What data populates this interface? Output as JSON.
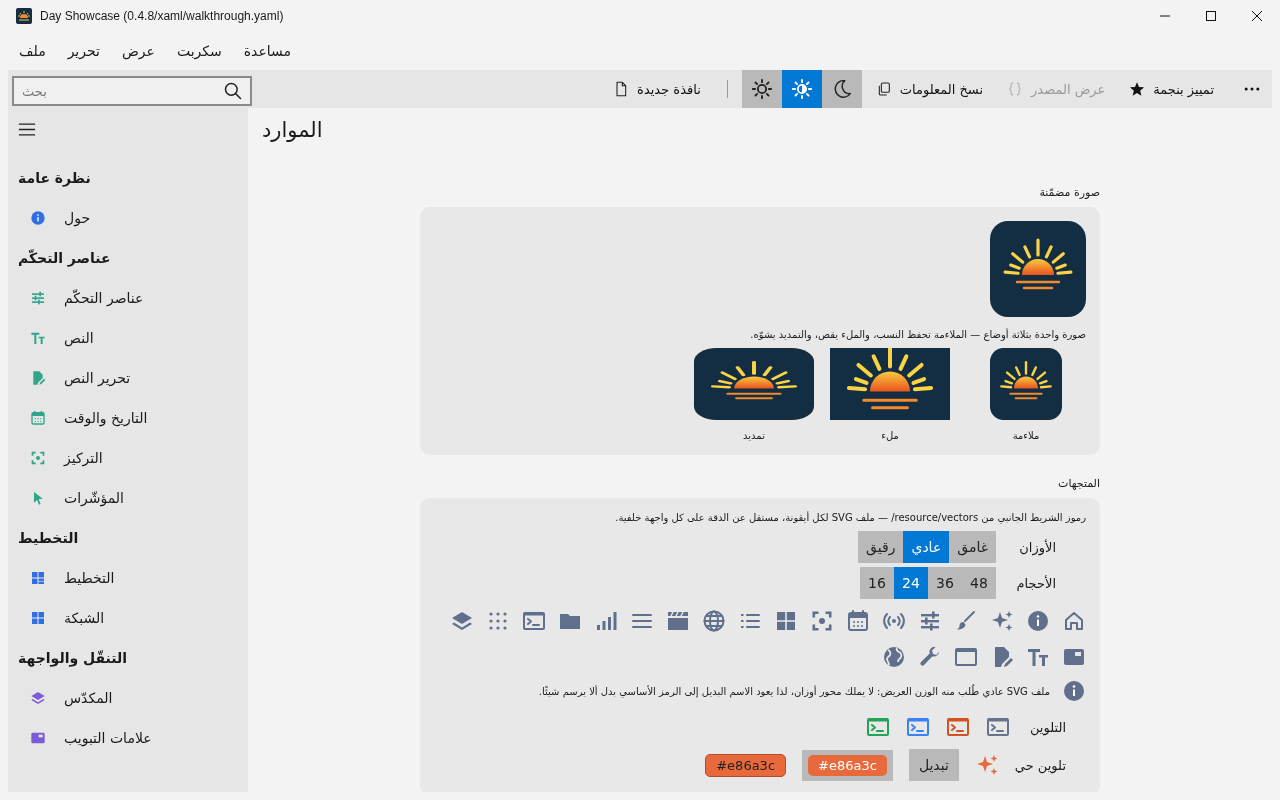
{
  "window": {
    "title": "Day Showcase (0.4.8/xaml/walkthrough.yaml)"
  },
  "menu": [
    "مساعدة",
    "سكربت",
    "عرض",
    "تحرير",
    "ملف"
  ],
  "search": {
    "placeholder": "بحث"
  },
  "toolbar": {
    "new_window": "نافذة جديدة",
    "theme": [
      {
        "selected": false
      },
      {
        "selected": true
      },
      {
        "selected": false
      }
    ],
    "copy_info": "نسخ المعلومات",
    "view_source": {
      "label": "عرض المصدر",
      "disabled": true
    },
    "star": "تمييز بنجمة"
  },
  "sidebar": {
    "groups": [
      {
        "heading": "نظرة عامة",
        "items": [
          {
            "label": "حول",
            "color": "#2f6fe0"
          }
        ]
      },
      {
        "heading": "عناصر التحكّم",
        "items": [
          {
            "label": "عناصر التحكّم",
            "color": "#2fa58a"
          },
          {
            "label": "النص",
            "color": "#2fa58a"
          },
          {
            "label": "تحرير النص",
            "color": "#2fa58a"
          },
          {
            "label": "التاريخ والوقت",
            "color": "#2fa58a"
          },
          {
            "label": "التركيز",
            "color": "#2fa58a"
          },
          {
            "label": "المؤشّرات",
            "color": "#2fa58a"
          }
        ]
      },
      {
        "heading": "التخطيط",
        "items": [
          {
            "label": "التخطيط",
            "color": "#2f6fe0"
          },
          {
            "label": "الشبكة",
            "color": "#2f6fe0"
          }
        ]
      },
      {
        "heading": "التنقّل والواجهة",
        "items": [
          {
            "label": "المكدّس",
            "color": "#7b5bd6"
          },
          {
            "label": "علامات التبويب",
            "color": "#7b5bd6"
          }
        ]
      }
    ]
  },
  "page_title": "الموارد",
  "embedded_image": {
    "heading": "صورة مضمّنة",
    "caption": "صورة واحدة بثلاثة أوضاع — الملاءمة تحفظ النسب، والملء يقص، والتمديد يشوّه.",
    "modes": [
      {
        "label": "ملاءمة",
        "kind": "fit"
      },
      {
        "label": "ملء",
        "kind": "fill"
      },
      {
        "label": "تمديد",
        "kind": "stretch"
      }
    ]
  },
  "vectors": {
    "heading": "المتجهات",
    "description": "رموز الشريط الجانبي من resource/vectors/ — ملف SVG لكل أيقونة، مستقل عن الدقة على كل واجهة خلفية.",
    "weights": {
      "label": "الأوزان",
      "options": [
        {
          "label": "غامق",
          "selected": false
        },
        {
          "label": "عادي",
          "selected": true
        },
        {
          "label": "رقيق",
          "selected": false
        }
      ]
    },
    "sizes": {
      "label": "الأحجام",
      "options": [
        {
          "label": "48",
          "selected": false
        },
        {
          "label": "36",
          "selected": false
        },
        {
          "label": "24",
          "selected": true
        },
        {
          "label": "16",
          "selected": false
        }
      ]
    },
    "note": "ملف SVG عادي طُلب منه الوزن العريض: لا يملك محور أوزان، لذا يعود الاسم البديل إلى الرمز الأساسي بدل ألا يرسم شيئًا.",
    "tint": {
      "label": "التلوين",
      "colors": [
        {
          "color": "#64748b"
        },
        {
          "color": "#d2521f"
        },
        {
          "color": "#3b82f6"
        },
        {
          "color": "#22a355"
        }
      ]
    },
    "live_tint": {
      "label": "تلوين حي",
      "color": "#e86a3c",
      "toggle": "تبديل",
      "chips": [
        "#e86a3c",
        "#e86a3c"
      ]
    }
  }
}
